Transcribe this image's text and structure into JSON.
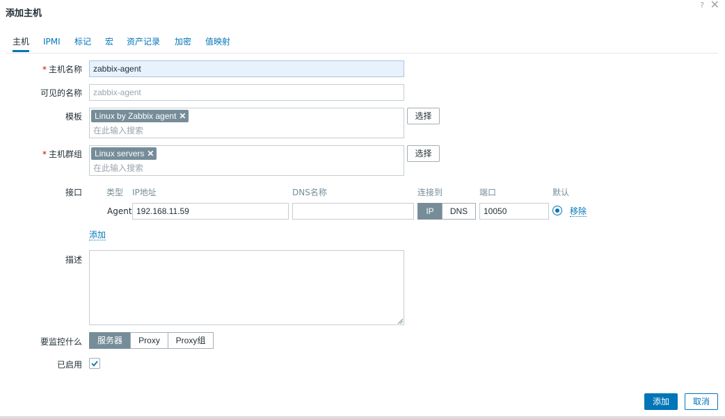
{
  "dialog": {
    "title": "添加主机",
    "help_glyph": "?",
    "close_glyph": "✕"
  },
  "tabs": [
    {
      "label": "主机",
      "active": true
    },
    {
      "label": "IPMI"
    },
    {
      "label": "标记"
    },
    {
      "label": "宏"
    },
    {
      "label": "资产记录"
    },
    {
      "label": "加密"
    },
    {
      "label": "值映射"
    }
  ],
  "form": {
    "host_name": {
      "label": "主机名称",
      "required_mark": "*",
      "value": "zabbix-agent"
    },
    "visible_name": {
      "label": "可见的名称",
      "placeholder": "zabbix-agent"
    },
    "templates": {
      "label": "模板",
      "chip": "Linux by Zabbix agent",
      "search_placeholder": "在此输入搜索",
      "select_label": "选择"
    },
    "host_groups": {
      "label": "主机群组",
      "required_mark": "*",
      "chip": "Linux servers",
      "search_placeholder": "在此输入搜索",
      "select_label": "选择"
    },
    "interfaces": {
      "label": "接口",
      "headers": {
        "type": "类型",
        "ip": "IP地址",
        "dns": "DNS名称",
        "connect": "连接到",
        "port": "端口",
        "default": "默认"
      },
      "row": {
        "type": "Agent",
        "ip": "192.168.11.59",
        "dns": "",
        "connect_ip": "IP",
        "connect_dns": "DNS",
        "port": "10050",
        "remove_label": "移除"
      },
      "add_label": "添加"
    },
    "description": {
      "label": "描述",
      "value": ""
    },
    "monitored_by": {
      "label": "要监控什么",
      "options": [
        "服务器",
        "Proxy",
        "Proxy组"
      ],
      "selected": "服务器"
    },
    "enabled": {
      "label": "已启用",
      "checked": true
    }
  },
  "footer": {
    "add_label": "添加",
    "cancel_label": "取消"
  },
  "colors": {
    "accent": "#0275b8",
    "chip_bg": "#768d99",
    "required": "#d40000",
    "focus_bg": "#e8f2fd"
  }
}
